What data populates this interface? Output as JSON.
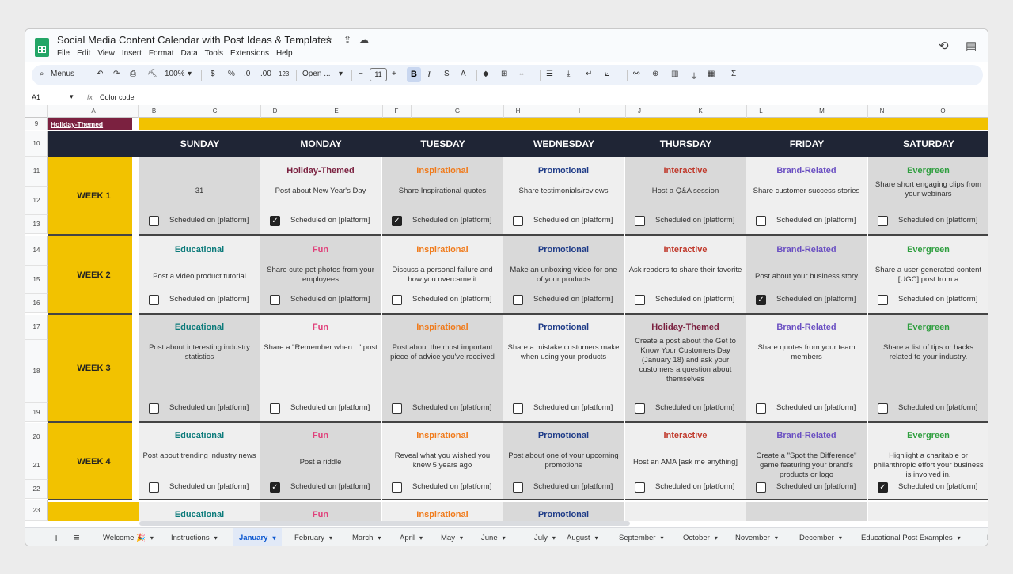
{
  "doc": {
    "title": "Social Media Content Calendar with Post Ideas & Templates",
    "menu": [
      "File",
      "Edit",
      "View",
      "Insert",
      "Format",
      "Data",
      "Tools",
      "Extensions",
      "Help"
    ]
  },
  "toolbar": {
    "menus_label": "Menus",
    "zoom": "100%",
    "currency": "$",
    "percent": "%",
    "dec_decrease": ".0",
    "dec_increase": ".00",
    "number_format": "123",
    "font": "Open ...",
    "font_size": "11",
    "minus": "−",
    "plus": "+",
    "bold": "B",
    "italic": "I",
    "strike": "S",
    "textcolor": "A",
    "sigma": "Σ"
  },
  "formula": {
    "cell_ref": "A1",
    "fx": "fx",
    "content": "Color code"
  },
  "columns": [
    "A",
    "B",
    "C",
    "D",
    "E",
    "F",
    "G",
    "H",
    "I",
    "J",
    "K",
    "L",
    "M",
    "N",
    "O"
  ],
  "rows": [
    "9",
    "10",
    "11",
    "12",
    "13",
    "14",
    "15",
    "16",
    "17",
    "18",
    "19",
    "20",
    "21",
    "22",
    "23"
  ],
  "a9_label": "Holiday-Themed",
  "days": [
    "SUNDAY",
    "MONDAY",
    "TUESDAY",
    "WEDNESDAY",
    "THURSDAY",
    "FRIDAY",
    "SATURDAY"
  ],
  "schedule_label": "Scheduled on [platform]",
  "colors": {
    "Educational": "#0b7a7a",
    "Fun": "#e0407a",
    "Inspirational": "#f07a1a",
    "Promotional": "#1f3c88",
    "Interactive": "#c0392b",
    "Brand-Related": "#6a4fc2",
    "Evergreen": "#2e9e3e",
    "Holiday-Themed": "#7b2140"
  },
  "weeks": [
    {
      "label": "WEEK 1",
      "cells": [
        {
          "category": "",
          "idea": "31",
          "checked": false,
          "shade": true
        },
        {
          "category": "Holiday-Themed",
          "idea": "Post about New Year's Day",
          "checked": true,
          "shade": false
        },
        {
          "category": "Inspirational",
          "idea": "Share Inspirational quotes",
          "checked": true,
          "shade": true
        },
        {
          "category": "Promotional",
          "idea": "Share testimonials/reviews",
          "checked": false,
          "shade": false
        },
        {
          "category": "Interactive",
          "idea": "Host a Q&A session",
          "checked": false,
          "shade": true
        },
        {
          "category": "Brand-Related",
          "idea": "Share customer success stories",
          "checked": false,
          "shade": false
        },
        {
          "category": "Evergreen",
          "idea": "Share short engaging clips from your webinars",
          "checked": false,
          "shade": true
        }
      ]
    },
    {
      "label": "WEEK 2",
      "cells": [
        {
          "category": "Educational",
          "idea": "Post a video product tutorial",
          "checked": false,
          "shade": false
        },
        {
          "category": "Fun",
          "idea": "Share cute pet photos from your employees",
          "checked": false,
          "shade": true
        },
        {
          "category": "Inspirational",
          "idea": "Discuss a personal failure and how you overcame it",
          "checked": false,
          "shade": false
        },
        {
          "category": "Promotional",
          "idea": "Make an unboxing video for one of your products",
          "checked": false,
          "shade": true
        },
        {
          "category": "Interactive",
          "idea": "Ask readers to share their favorite",
          "checked": false,
          "shade": false
        },
        {
          "category": "Brand-Related",
          "idea": "Post about your business story",
          "checked": true,
          "shade": true
        },
        {
          "category": "Evergreen",
          "idea": "Share a user-generated content [UGC] post from a",
          "checked": false,
          "shade": false
        }
      ]
    },
    {
      "label": "WEEK 3",
      "cells": [
        {
          "category": "Educational",
          "idea": "Post about interesting industry statistics",
          "checked": false,
          "shade": true
        },
        {
          "category": "Fun",
          "idea": "Share a \"Remember when...\" post",
          "checked": false,
          "shade": false
        },
        {
          "category": "Inspirational",
          "idea": "Post about the most important piece of advice you've received",
          "checked": false,
          "shade": true
        },
        {
          "category": "Promotional",
          "idea": "Share a mistake customers make when using your products",
          "checked": false,
          "shade": false
        },
        {
          "category": "Holiday-Themed",
          "idea": "Create a post about the Get to Know Your Customers Day (January 18) and ask your customers a question about themselves",
          "checked": false,
          "shade": true
        },
        {
          "category": "Brand-Related",
          "idea": "Share quotes from your team members",
          "checked": false,
          "shade": false
        },
        {
          "category": "Evergreen",
          "idea": "Share a list of tips or hacks related to your industry.",
          "checked": false,
          "shade": true
        }
      ]
    },
    {
      "label": "WEEK 4",
      "cells": [
        {
          "category": "Educational",
          "idea": "Post about trending industry news",
          "checked": false,
          "shade": false
        },
        {
          "category": "Fun",
          "idea": "Post a riddle",
          "checked": true,
          "shade": true
        },
        {
          "category": "Inspirational",
          "idea": "Reveal what you wished you knew 5 years ago",
          "checked": false,
          "shade": false
        },
        {
          "category": "Promotional",
          "idea": "Post about one of your upcoming promotions",
          "checked": false,
          "shade": true
        },
        {
          "category": "Interactive",
          "idea": "Host an AMA [ask me anything]",
          "checked": false,
          "shade": false
        },
        {
          "category": "Brand-Related",
          "idea": "Create a \"Spot the Difference\" game featuring your brand's products or logo",
          "checked": false,
          "shade": true
        },
        {
          "category": "Evergreen",
          "idea": "Highlight a charitable or philanthropic effort your business is involved in.",
          "checked": true,
          "shade": false
        }
      ]
    }
  ],
  "partial_row": [
    "Educational",
    "Fun",
    "Inspirational",
    "Promotional"
  ],
  "sheet_tabs": [
    "Welcome 🎉",
    "Instructions",
    "January",
    "February",
    "March",
    "April",
    "May",
    "June",
    "July",
    "August",
    "September",
    "October",
    "November",
    "December",
    "Educational Post Examples",
    "F"
  ],
  "active_tab": "January"
}
